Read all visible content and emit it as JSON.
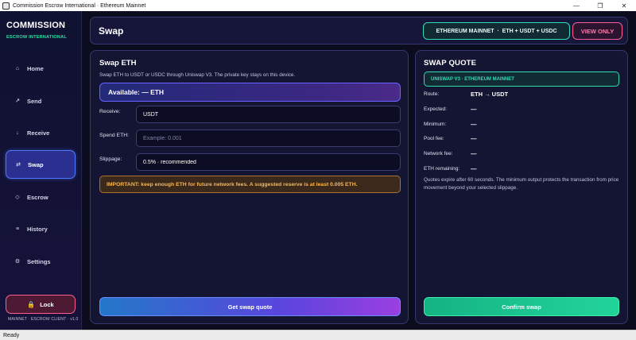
{
  "window": {
    "title": "Commission Escrow International · Ethereum Mainnet",
    "minimize": "—",
    "maximize": "❐",
    "close": "✕"
  },
  "status_bar": {
    "text": "Ready"
  },
  "sidebar": {
    "brand_title": "COMMISSION",
    "brand_subtitle": "ESCROW INTERNATIONAL",
    "items": [
      {
        "label": "Home",
        "icon": "⌂",
        "icon_name": "home-icon"
      },
      {
        "label": "Send",
        "icon": "↗",
        "icon_name": "send-arrow-icon"
      },
      {
        "label": "Receive",
        "icon": "↓",
        "icon_name": "receive-arrow-icon"
      },
      {
        "label": "Swap",
        "icon": "⇄",
        "icon_name": "swap-icon"
      },
      {
        "label": "Escrow",
        "icon": "◇",
        "icon_name": "escrow-diamond-icon"
      },
      {
        "label": "History",
        "icon": "≡",
        "icon_name": "history-list-icon"
      },
      {
        "label": "Settings",
        "icon": "⚙",
        "icon_name": "gear-icon"
      }
    ],
    "active_item": "Swap",
    "lock_label": "Lock",
    "lock_icon": "🔒",
    "version": "MAINNET · ESCROW CLIENT · v1.0"
  },
  "header": {
    "title": "Swap",
    "network_badge": "ETHEREUM MAINNET  ·  ETH + USDT + USDC",
    "view_badge": "VIEW ONLY"
  },
  "swap_panel": {
    "title": "Swap ETH",
    "description": "Swap ETH to USDT or USDC through Uniswap V3. The private key stays on this device.",
    "available": "Available: — ETH",
    "receive_label": "Receive:",
    "receive_value": "USDT",
    "spend_label": "Spend ETH:",
    "spend_value": "",
    "spend_placeholder": "Example: 0.001",
    "slippage_label": "Slippage:",
    "slippage_value": "0.5% · recommended",
    "warning": "IMPORTANT: keep enough ETH for future network fees. A suggested reserve is at least 0.005 ETH.",
    "quote_button": "Get swap quote"
  },
  "quote_panel": {
    "title": "SWAP QUOTE",
    "provider": "UNISWAP V3 · ETHEREUM MAINNET",
    "rows": [
      {
        "label": "Route:",
        "value": "ETH → USDT"
      },
      {
        "label": "Expected:",
        "value": "—"
      },
      {
        "label": "Minimum:",
        "value": "—"
      },
      {
        "label": "Pool fee:",
        "value": "—"
      },
      {
        "label": "Network fee:",
        "value": "—"
      },
      {
        "label": "ETH remaining:",
        "value": "—"
      }
    ],
    "note": "Quotes expire after 60 seconds. The minimum output protects the transaction from price movement beyond your selected slippage.",
    "confirm_button": "Confirm swap"
  },
  "colors": {
    "background": "#0b0c1e",
    "accent_green": "#2de0b0",
    "accent_pink": "#ff5d92",
    "accent_blue": "#4b78ff",
    "warning_orange": "#ffb64a"
  }
}
